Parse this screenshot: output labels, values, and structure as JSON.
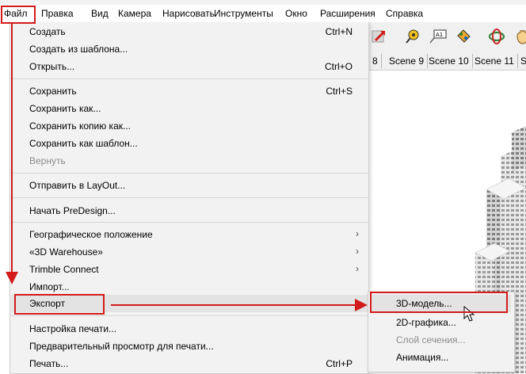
{
  "menubar": {
    "items": [
      "Файл",
      "Правка",
      "Вид",
      "Камера",
      "Нарисовать",
      "Инструменты",
      "Окно",
      "Расширения",
      "Справка"
    ]
  },
  "file_menu": {
    "items": [
      {
        "label": "Создать",
        "shortcut": "Ctrl+N"
      },
      {
        "label": "Создать из шаблона..."
      },
      {
        "label": "Открыть...",
        "shortcut": "Ctrl+O"
      },
      {
        "label": "Сохранить",
        "shortcut": "Ctrl+S"
      },
      {
        "label": "Сохранить как..."
      },
      {
        "label": "Сохранить копию как..."
      },
      {
        "label": "Сохранить как шаблон..."
      },
      {
        "label": "Вернуть",
        "disabled": true
      },
      {
        "label": "Отправить в LayOut..."
      },
      {
        "label": "Начать PreDesign..."
      },
      {
        "label": "Географическое положение",
        "submenu": true
      },
      {
        "label": "«3D Warehouse»",
        "submenu": true
      },
      {
        "label": "Trimble Connect",
        "submenu": true
      },
      {
        "label": "Импорт..."
      },
      {
        "label": "Экспорт",
        "submenu": true,
        "highlighted": true
      },
      {
        "label": "Настройка печати..."
      },
      {
        "label": "Предварительный просмотр для печати..."
      },
      {
        "label": "Печать...",
        "shortcut": "Ctrl+P"
      }
    ]
  },
  "export_submenu": {
    "items": [
      {
        "label": "3D-модель...",
        "highlighted": true
      },
      {
        "label": "2D-графика..."
      },
      {
        "label": "Слой сечения...",
        "disabled": true
      },
      {
        "label": "Анимация..."
      }
    ]
  },
  "scene_tabs": [
    "8",
    "Scene 9",
    "Scene 10",
    "Scene 11",
    "S"
  ],
  "icons": [
    "orbit-arrow-icon",
    "tape-measure-icon",
    "text-icon",
    "paint-bucket-icon",
    "orbit-icon",
    "hand-pan-icon"
  ],
  "colors": {
    "annotation_red": "#d31b1b",
    "menu_bg": "#f2f2f2",
    "highlight": "#e3e3e3",
    "disabled": "#8c8c8c"
  }
}
